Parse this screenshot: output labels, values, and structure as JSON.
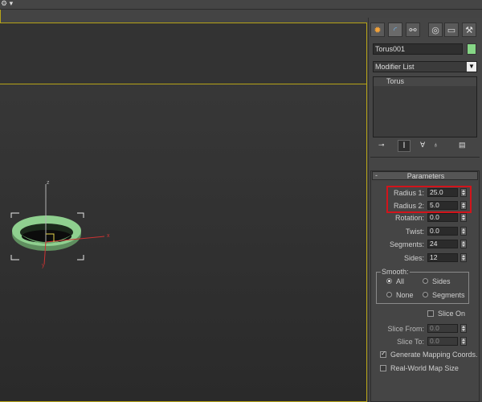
{
  "top_icon": "⚙ ▾",
  "object_name": "Torus001",
  "object_color": "#86d686",
  "modifier_list": "Modifier List",
  "stack_items": [
    "Torus"
  ],
  "rollout_title": "Parameters",
  "rollout_toggle": "-",
  "parameters": [
    {
      "label": "Radius 1:",
      "value": "25.0"
    },
    {
      "label": "Radius 2:",
      "value": "5.0"
    },
    {
      "label": "Rotation:",
      "value": "0.0"
    },
    {
      "label": "Twist:",
      "value": "0.0"
    },
    {
      "label": "Segments:",
      "value": "24"
    },
    {
      "label": "Sides:",
      "value": "12"
    }
  ],
  "smooth": {
    "title": "Smooth:",
    "options": [
      "All",
      "Sides",
      "None",
      "Segments"
    ],
    "selected": "All"
  },
  "slice_on": "Slice On",
  "slice_from": {
    "label": "Slice From:",
    "value": "0.0"
  },
  "slice_to": {
    "label": "Slice To:",
    "value": "0.0"
  },
  "gen_mapping": "Generate Mapping Coords.",
  "real_world": "Real-World Map Size",
  "gizmo": {
    "z": "z",
    "x": "x",
    "y": "y"
  },
  "highlight_color": "#d2141b",
  "viewport_border_color": "#b6a318"
}
